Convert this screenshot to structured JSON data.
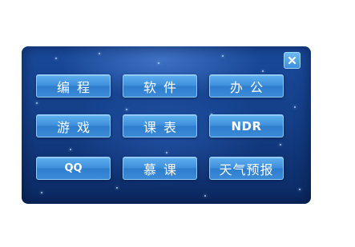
{
  "window": {
    "close_icon": "close-icon"
  },
  "buttons": [
    {
      "id": "programming",
      "label": "编程"
    },
    {
      "id": "software",
      "label": "软件"
    },
    {
      "id": "office",
      "label": "办公"
    },
    {
      "id": "games",
      "label": "游戏"
    },
    {
      "id": "timetable",
      "label": "课表"
    },
    {
      "id": "ndr",
      "label": "NDR"
    },
    {
      "id": "qq",
      "label": "QQ"
    },
    {
      "id": "mooc",
      "label": "慕课"
    },
    {
      "id": "weather",
      "label": "天气预报"
    }
  ],
  "colors": {
    "panel_background": "#143f88",
    "button_fill": "#3d8fdc",
    "button_border": "#8fcaf6",
    "text": "#ffffff"
  }
}
